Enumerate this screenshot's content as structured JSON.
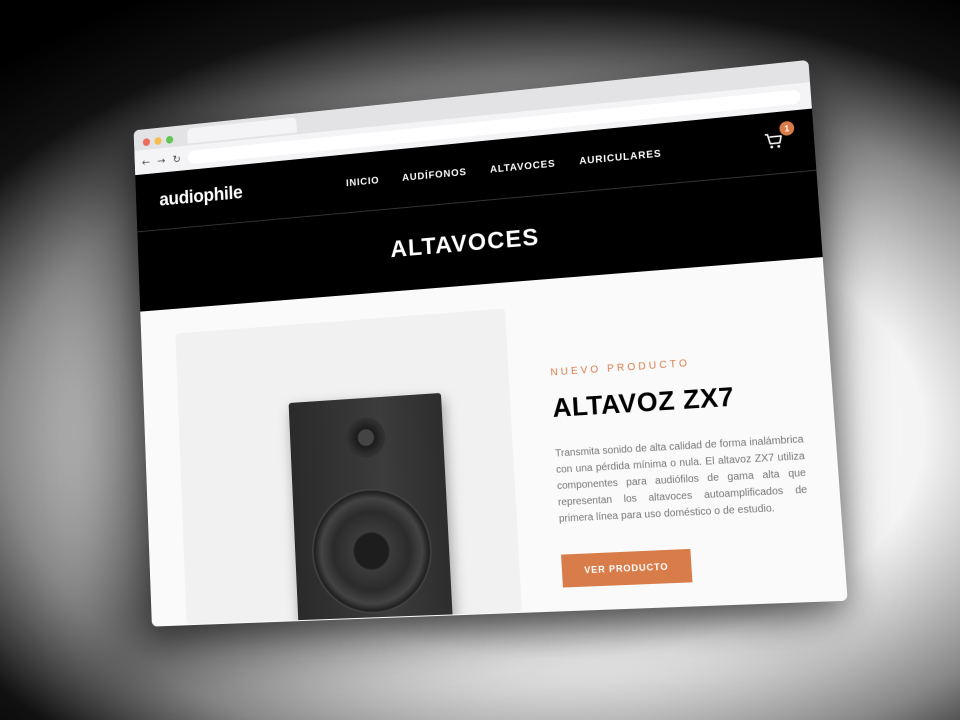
{
  "browser": {
    "traffic_lights": {
      "close": "#ed6a5e",
      "minimize": "#f5bf4f",
      "zoom": "#61c554"
    },
    "back_icon": "←",
    "forward_icon": "→",
    "reload_icon": "↻"
  },
  "header": {
    "logo": "audiophile",
    "nav": [
      "INICIO",
      "AUDÍFONOS",
      "ALTAVOCES",
      "AURICULARES"
    ],
    "cart_count": "1"
  },
  "hero": {
    "title": "ALTAVOCES"
  },
  "product": {
    "overline": "NUEVO PRODUCTO",
    "name": "ALTAVOZ ZX7",
    "description": "Transmita sonido de alta calidad de forma inalámbrica con una pérdida mínima o nula. El altavoz ZX7 utiliza componentes para audiófilos de gama alta que representan los altavoces autoamplificados de primera línea para uso doméstico o de estudio.",
    "cta": "VER PRODUCTO"
  },
  "colors": {
    "accent": "#d87d4a",
    "header_bg": "#000000",
    "page_bg": "#fafafa"
  }
}
